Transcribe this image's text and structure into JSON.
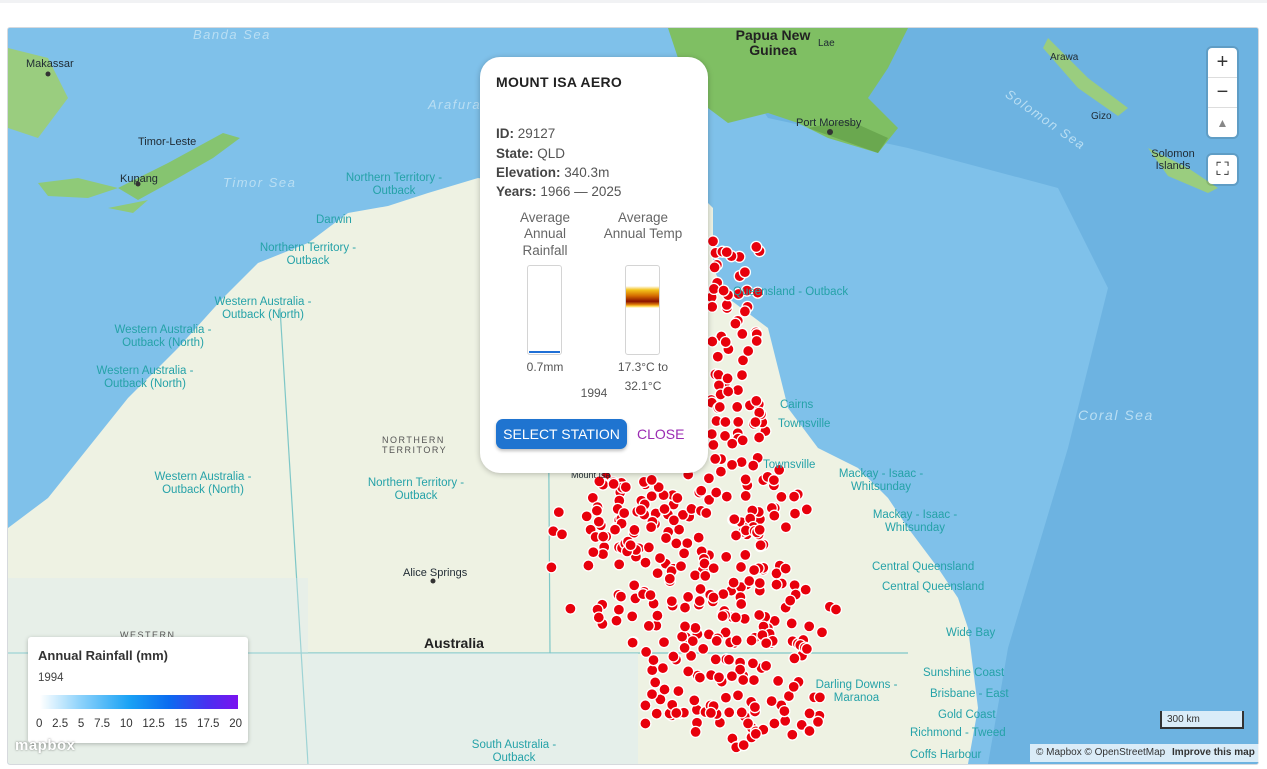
{
  "map": {
    "water_labels": [
      "Banda Sea",
      "Arafura Sea",
      "Timor Sea",
      "Solomon Sea",
      "Coral Sea"
    ],
    "country_labels": [
      "Papua New Guinea",
      "Timor-Leste",
      "Australia",
      "Solomon Islands"
    ],
    "region_labels": {
      "nt_outback_1": "Northern Territory - Outback",
      "nt_outback_2": "Northern Territory - Outback",
      "nt_outback_3": "Northern Territory - Outback",
      "wa_outback_1": "Western Australia - Outback (North)",
      "wa_outback_2": "Western Australia - Outback (North)",
      "wa_outback_3": "Western Australia - Outback (North)",
      "wa_outback_4": "Western Australia - Outback (North)",
      "qld_outback": "Queensland - Outback",
      "cairns": "Cairns",
      "townsville_1": "Townsville",
      "townsville_2": "Townsville",
      "mackay_1": "Mackay - Isaac - Whitsunday",
      "mackay_2": "Mackay - Isaac - Whitsunday",
      "central_qld_1": "Central Queensland",
      "central_qld_2": "Central Queensland",
      "wide_bay": "Wide Bay",
      "sunshine_coast": "Sunshine Coast",
      "brisbane_east": "Brisbane - East",
      "gold_coast": "Gold Coast",
      "darling_downs": "Darling Downs - Maranoa",
      "richmond_tweed": "Richmond - Tweed",
      "coffs_harbour": "Coffs Harbour",
      "sa_outback": "South Australia - Outback",
      "nt_state": "NORTHERN TERRITORY",
      "western": "WESTERN"
    },
    "city_labels": [
      "Makassar",
      "Kupang",
      "Darwin",
      "Port Moresby",
      "Lae",
      "Arawa",
      "Gizo",
      "Alice Springs",
      "Mount Isa"
    ]
  },
  "controls": {
    "zoom_in": "+",
    "zoom_out": "−",
    "compass": "▲",
    "fullscreen": "⛶"
  },
  "popup": {
    "title": "MOUNT ISA AERO",
    "id_label": "ID:",
    "id_value": "29127",
    "state_label": "State:",
    "state_value": "QLD",
    "elev_label": "Elevation:",
    "elev_value": "340.3m",
    "years_label": "Years:",
    "years_value": "1966 — 2025",
    "rain_title": "Average Annual Rainfall",
    "temp_title": "Average Annual Temp",
    "rain_value": "0.7mm",
    "temp_value": "17.3°C to 32.1°C",
    "year": "1994",
    "select_label": "SELECT STATION",
    "close_label": "CLOSE"
  },
  "legend": {
    "title": "Annual Rainfall (mm)",
    "year": "1994",
    "ticks": [
      "0",
      "2.5",
      "5",
      "7.5",
      "10",
      "12.5",
      "15",
      "17.5",
      "20"
    ]
  },
  "scale": {
    "label": "300 km"
  },
  "attribution": {
    "text": "© Mapbox © OpenStreetMap",
    "improve": "Improve this map"
  },
  "logo": {
    "text": "mapbox"
  },
  "colors": {
    "station_marker": "#e8000c",
    "ocean": "#7fc1ea",
    "land": "#edf2e4",
    "accent_button": "#1f74d0",
    "close_text": "#9b2bb3"
  }
}
